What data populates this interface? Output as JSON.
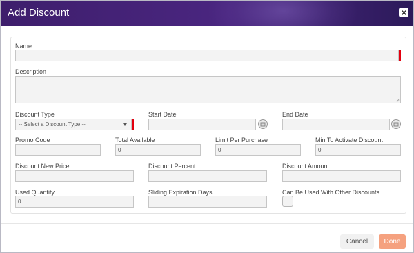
{
  "dialog": {
    "title": "Add Discount",
    "close_icon": "close-icon"
  },
  "form": {
    "name": {
      "label": "Name",
      "value": ""
    },
    "description": {
      "label": "Description",
      "value": ""
    },
    "discount_type": {
      "label": "Discount Type",
      "selected": "-- Select a Discount Type --"
    },
    "start_date": {
      "label": "Start Date",
      "value": ""
    },
    "end_date": {
      "label": "End Date",
      "value": ""
    },
    "promo_code": {
      "label": "Promo Code",
      "value": ""
    },
    "total_available": {
      "label": "Total Available",
      "value": "0"
    },
    "limit_per_purchase": {
      "label": "Limit Per Purchase",
      "value": "0"
    },
    "min_to_activate": {
      "label": "Min To Activate Discount",
      "value": "0"
    },
    "discount_new_price": {
      "label": "Discount New Price",
      "value": ""
    },
    "discount_percent": {
      "label": "Discount Percent",
      "value": ""
    },
    "discount_amount": {
      "label": "Discount Amount",
      "value": ""
    },
    "used_quantity": {
      "label": "Used Quantity",
      "value": "0"
    },
    "sliding_expiration_days": {
      "label": "Sliding Expiration Days",
      "value": ""
    },
    "combinable": {
      "label": "Can Be Used With Other Discounts",
      "checked": false
    }
  },
  "footer": {
    "cancel_label": "Cancel",
    "done_label": "Done"
  },
  "colors": {
    "header": "#3e1e6c",
    "required_marker": "#e3000f",
    "done_button": "#f5a17f"
  }
}
